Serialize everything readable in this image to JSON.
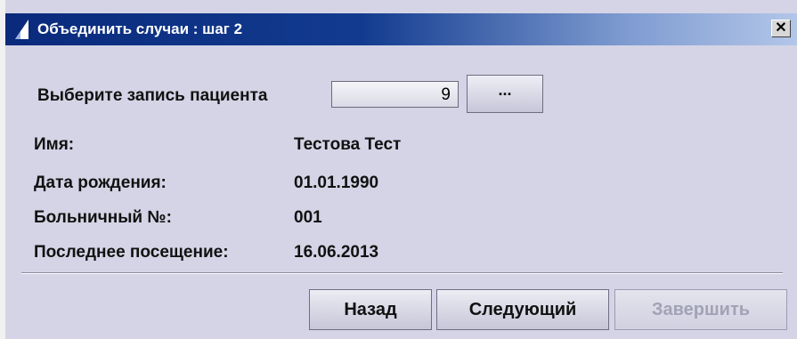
{
  "window": {
    "title": "Объединить случаи : шаг 2",
    "close_label": "✕"
  },
  "patient": {
    "select_label": "Выберите запись пациента",
    "record_value": "9",
    "browse_label": "..."
  },
  "details": {
    "name_label": "Имя:",
    "name_value": "Тестова Тест",
    "dob_label": "Дата рождения:",
    "dob_value": "01.01.1990",
    "hospital_no_label": "Больничный №:",
    "hospital_no_value": "001",
    "last_visit_label": "Последнее посещение:",
    "last_visit_value": "16.06.2013"
  },
  "buttons": {
    "back": "Назад",
    "next": "Следующий",
    "finish": "Завершить",
    "finish_enabled": false
  },
  "colors": {
    "dialog_bg": "#d4d4e6",
    "titlebar_start": "#0a2a7c",
    "titlebar_end": "#b3c6e8",
    "disabled_text": "#a2a2b6"
  }
}
